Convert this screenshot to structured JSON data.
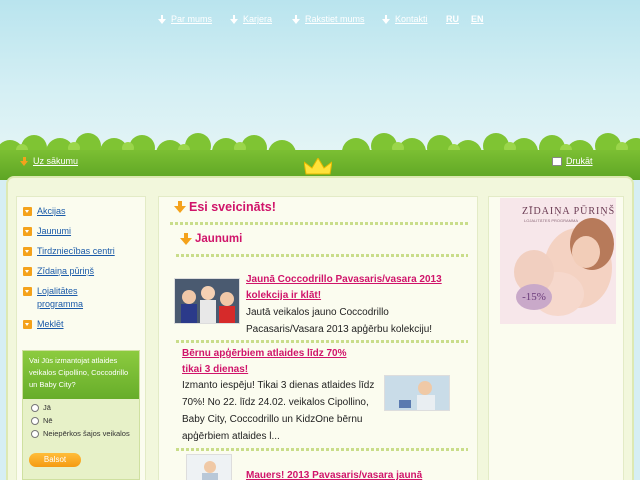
{
  "top_nav": {
    "items": [
      {
        "label": "Par mums"
      },
      {
        "label": "Karjera"
      },
      {
        "label": "Rakstiet mums"
      },
      {
        "label": "Kontakti"
      }
    ],
    "languages": [
      "RU",
      "EN"
    ]
  },
  "sub_nav": {
    "home_label": "Uz sākumu",
    "print_label": "Drukāt"
  },
  "sidebar": {
    "items": [
      {
        "label": "Akcijas"
      },
      {
        "label": "Jaunumi"
      },
      {
        "label": "Tirdzniecības centri"
      },
      {
        "label": "Zīdaiņa pūriņš"
      },
      {
        "label": "Lojalitātes programma"
      },
      {
        "label": "Meklēt"
      }
    ]
  },
  "poll": {
    "question": "Vai Jūs izmantojat atlaides veikalos Cipollino, Coccodrillo un Baby City?",
    "options": [
      "Jā",
      "Nē",
      "Neiepērkos šajos veikalos"
    ],
    "submit_label": "Balsot"
  },
  "main": {
    "welcome_heading": "Esi sveicināts!",
    "news_heading": "Jaunumi",
    "news": [
      {
        "title": "Jaunā Coccodrillo Pavasaris/vasara 2013 kolekcija ir klāt!",
        "text": "Jautā veikalos jauno Coccodrillo Pacasaris/Vasara 2013 apģērbu kolekciju!"
      },
      {
        "title": "Bērnu apģērbiem atlaides līdz 70% tikai 3 dienas!",
        "text": "Izmanto iespēju! Tikai 3 dienas atlaides līdz 70%! No 22. līdz 24.02. veikalos Cipollino, Baby City, Coccodrillo un KidzOne bērnu apģērbiem atlaides l..."
      },
      {
        "title": "Mauers! 2013 Pavasaris/vasara jaunā"
      }
    ]
  },
  "ad": {
    "title": "ZĪDAIŅA PŪRIŅŠ",
    "subtitle": "LOJALITĀTES PROGRAMMA",
    "discount": "-15%"
  },
  "colors": {
    "accent_pink": "#d0146a",
    "link_blue": "#1a5aa8",
    "orange": "#f4a21b",
    "grass_green": "#6cb22c"
  }
}
